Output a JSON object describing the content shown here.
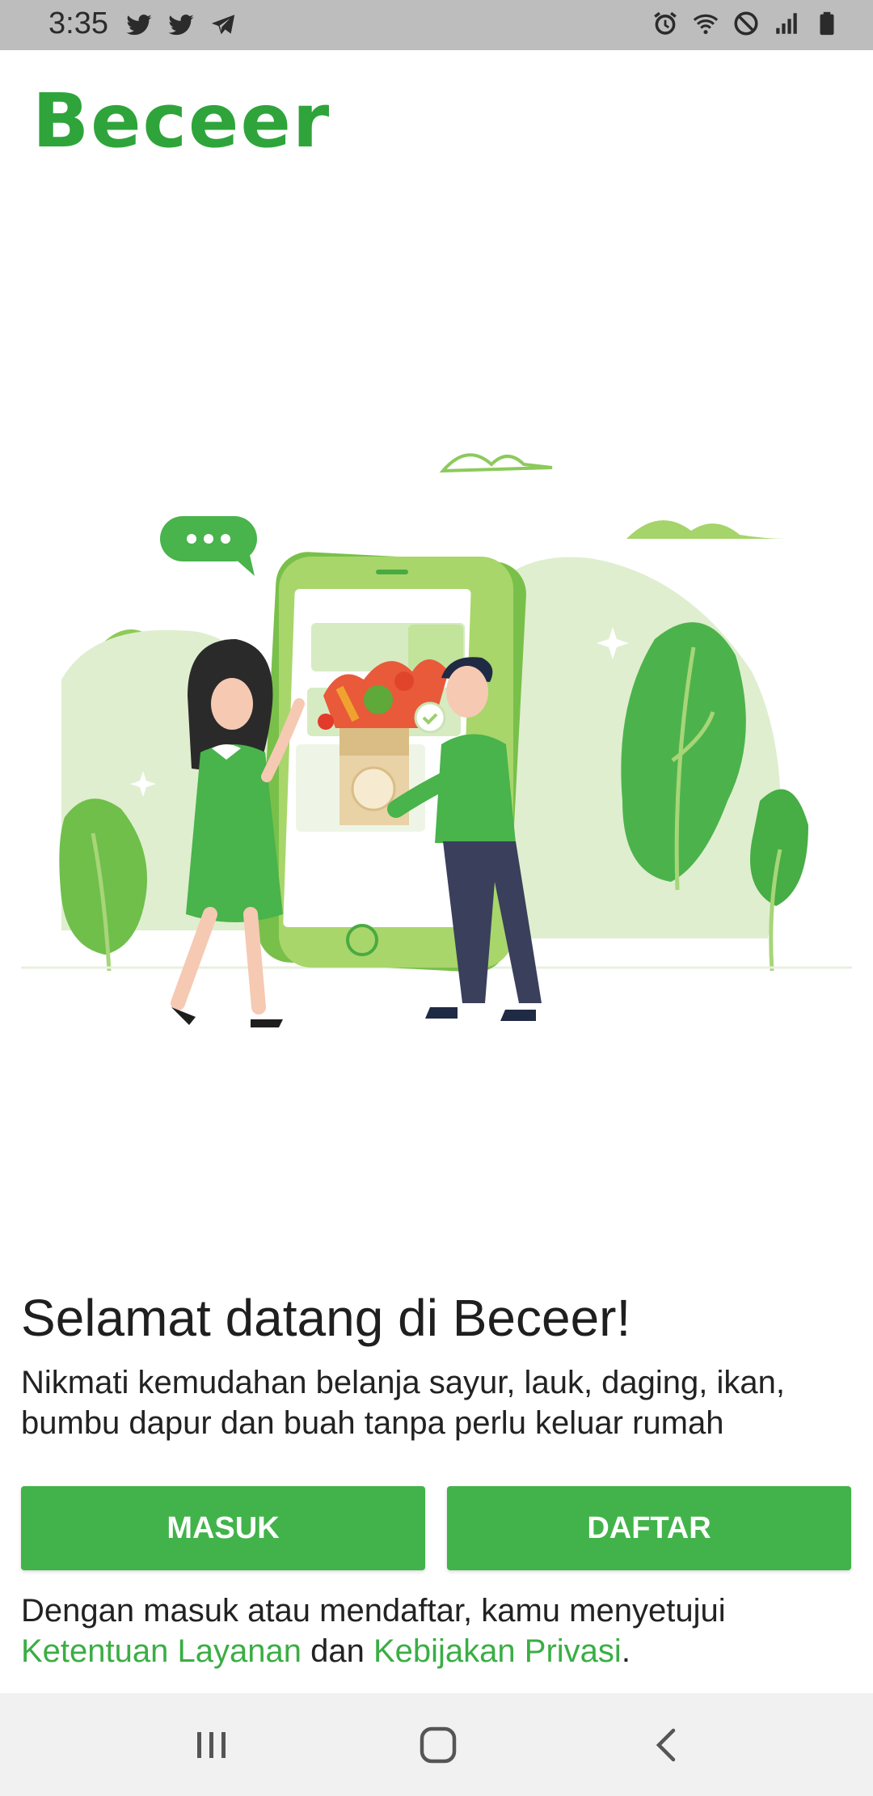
{
  "status_bar": {
    "time": "3:35",
    "left_icons": [
      "twitter-icon",
      "twitter-icon",
      "telegram-icon"
    ],
    "right_icons": [
      "alarm-icon",
      "wifi-icon",
      "do-not-disturb-icon",
      "signal-icon",
      "battery-icon"
    ]
  },
  "app": {
    "logo_text": "Beceer",
    "brand_color": "#41b34a"
  },
  "welcome": {
    "title": "Selamat datang di Beceer!",
    "description": "Nikmati kemudahan belanja sayur, lauk, daging, ikan, bumbu dapur dan buah tanpa perlu keluar rumah"
  },
  "buttons": {
    "login_label": "MASUK",
    "register_label": "DAFTAR"
  },
  "terms": {
    "prefix": "Dengan masuk atau mendaftar, kamu menyetujui",
    "terms_link": "Ketentuan Layanan",
    "conjunction": "dan",
    "privacy_link": "Kebijakan Privasi",
    "suffix": "."
  },
  "nav_bar": {
    "icons": [
      "recent-apps-icon",
      "home-icon",
      "back-icon"
    ]
  }
}
